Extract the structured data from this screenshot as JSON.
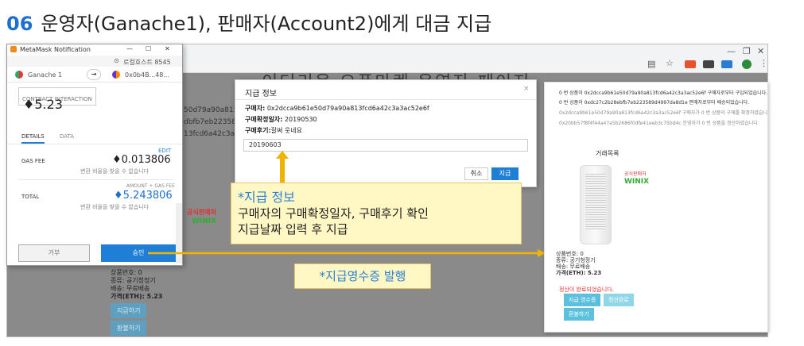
{
  "slide": {
    "number": "06",
    "title": "운영자(Ganache1), 판매자(Account2)에게 대금 지급"
  },
  "browser": {
    "page_heading": "이더리움 오픈마켓 운영자 페이지",
    "bg_hashes": [
      "50d79a90a813fc",
      "dbfb7eb22358",
      "13fcd6a42c3a"
    ],
    "bg_product": {
      "number": "상품번호: 0",
      "category": "종류: 공기청정기",
      "delivery": "배송: 무료배송",
      "price": "가격(ETH): 5.23"
    },
    "bg_buttons": [
      "지급하기",
      "환불하기"
    ]
  },
  "metamask": {
    "title": "MetaMask Notification",
    "network": "로컬호스트 8545",
    "from_account": "Ganache 1",
    "to_account": "0x0b4B...48...",
    "contract_interaction": "CONTRACT INTERACTION",
    "amount": "5.23",
    "tabs": [
      "DETAILS",
      "DATA"
    ],
    "edit_label": "EDIT",
    "gas_fee_label": "GAS FEE",
    "gas_fee": "0.013806",
    "gas_note": "변환 비율을 찾을 수 없습니다",
    "total_header": "AMOUNT + GAS FEE",
    "total_label": "TOTAL",
    "total": "5.243806",
    "total_note": "변환 비율을 찾을 수 없습니다",
    "reject_button": "거부",
    "confirm_button": "승인"
  },
  "dialog": {
    "title": "지급 정보",
    "buyer_label": "구매자:",
    "buyer_value": "0x2dcca9b61e50d79a90a813fcd6a42c3a3ac52e6f",
    "confirm_date_label": "구매확정일자:",
    "confirm_date_value": "20190530",
    "review_label": "구매후기:",
    "review_value": "잘써 웃네요",
    "pay_date_input": "20190603",
    "cancel_button": "취소",
    "pay_button": "지급"
  },
  "callout": {
    "title": "*지급 정보",
    "line1": "구매자의 구매확정일자, 구매후기 확인",
    "line2": "지급날짜 입력 후 지급"
  },
  "receipt_label": "*지급영수증 발행",
  "right_panel": {
    "logs": [
      {
        "text": "0 번 상품이 0x2dcca9b61e50d79a90a813fcd6a42c3a3ac52e6f 구매자로부터 구입되었습니다.",
        "dim": false
      },
      {
        "text": "0 번 상품이 0xdc27c2b28ebfb7eb223589d4997da8d1e 판매자로부터 배송되었습니다.",
        "dim": false
      },
      {
        "text": "0x2dcca9b61e50d79a90a813fcd6a42c3a3ac52e6f 구매자가 0 번 상품의 구매를 확정하였습니다.",
        "dim": true
      },
      {
        "text": "0x20bb57f8f4f44a47a5b2686f0dfe41eeb3c75bd4c 운영자가 0 번 상품을 정산하였습니다.",
        "dim": true
      }
    ],
    "product_list_title": "거래목록",
    "brand": "WINIX",
    "brand_tag": "공식판매처",
    "product_number": "상품번호: 0",
    "category": "종류: 공기청정기",
    "delivery": "배송: 무료배송",
    "price": "가격(ETH): 5.23",
    "status": "정산이 완료되었습니다.",
    "buttons": [
      "지급 영수증",
      "정산완료",
      "환불하기"
    ]
  },
  "colors": {
    "accent": "#1e6fd0",
    "callout_bg": "#fff7c4",
    "arrow": "#f0b400"
  }
}
